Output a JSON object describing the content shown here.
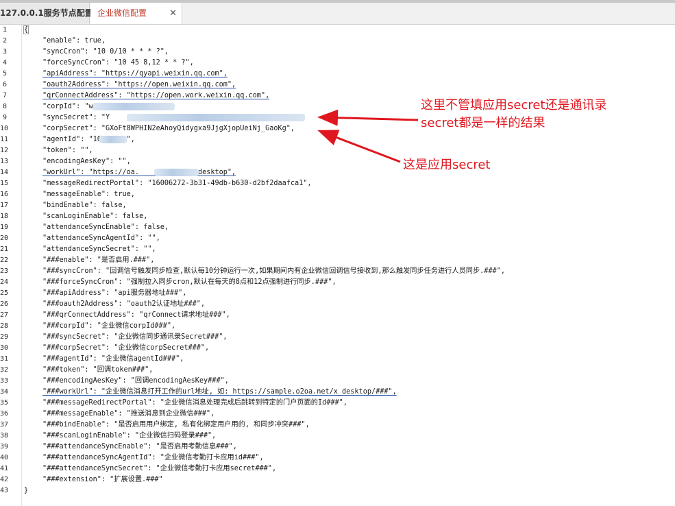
{
  "tabs": [
    {
      "label": "127.0.0.1服务节点配置"
    },
    {
      "label": "企业微信配置",
      "close": "✕"
    }
  ],
  "code_lines": [
    {
      "n": "1",
      "text": "{"
    },
    {
      "n": "2",
      "text": "\"enable\": true,"
    },
    {
      "n": "3",
      "text": "\"syncCron\": \"10 0/10 * * * ?\","
    },
    {
      "n": "4",
      "text": "\"forceSyncCron\": \"10 45 8,12 * * ?\","
    },
    {
      "n": "5",
      "text": "\"apiAddress\": \"https://qyapi.weixin.qq.com\","
    },
    {
      "n": "6",
      "text": "\"oauth2Address\": \"https://open.weixin.qq.com\","
    },
    {
      "n": "7",
      "text": "\"qrConnectAddress\": \"https://open.work.weixin.qq.com\","
    },
    {
      "n": "8",
      "text": "\"corpId\": \"w               d\","
    },
    {
      "n": "9",
      "text": "\"syncSecret\": \"Y                                M\","
    },
    {
      "n": "10",
      "text": "\"corpSecret\": \"GXoFt8WPHIN2eAhoyQidygxa9JjgXjopUeiNj_GaoKg\","
    },
    {
      "n": "11",
      "text": "\"agentId\": \"10    83\","
    },
    {
      "n": "12",
      "text": "\"token\": \"\","
    },
    {
      "n": "13",
      "text": "\"encodingAesKey\": \"\","
    },
    {
      "n": "14",
      "text": "\"workUrl\": \"https://oa.         om/x_desktop\","
    },
    {
      "n": "15",
      "text": "\"messageRedirectPortal\": \"16006272-3b31-49db-b630-d2bf2daafca1\","
    },
    {
      "n": "16",
      "text": "\"messageEnable\": true,"
    },
    {
      "n": "17",
      "text": "\"bindEnable\": false,"
    },
    {
      "n": "18",
      "text": "\"scanLoginEnable\": false,"
    },
    {
      "n": "19",
      "text": "\"attendanceSyncEnable\": false,"
    },
    {
      "n": "20",
      "text": "\"attendanceSyncAgentId\": \"\","
    },
    {
      "n": "21",
      "text": "\"attendanceSyncSecret\": \"\","
    },
    {
      "n": "22",
      "text": "\"###enable\": \"是否启用.###\","
    },
    {
      "n": "23",
      "text": "\"###syncCron\": \"回调信号触发同步检查,默认每10分钟运行一次,如果期间内有企业微信回调信号接收到,那么触发同步任务进行人员同步.###\","
    },
    {
      "n": "24",
      "text": "\"###forceSyncCron\": \"强制拉入同步cron,默认在每天的8点和12点强制进行同步.###\","
    },
    {
      "n": "25",
      "text": "\"###apiAddress\": \"api服务器地址###\","
    },
    {
      "n": "26",
      "text": "\"###oauth2Address\": \"oauth2认证地址###\","
    },
    {
      "n": "27",
      "text": "\"###qrConnectAddress\": \"qrConnect请求地址###\","
    },
    {
      "n": "28",
      "text": "\"###corpId\": \"企业微信corpId###\","
    },
    {
      "n": "29",
      "text": "\"###syncSecret\": \"企业微信同步通讯录Secret###\","
    },
    {
      "n": "30",
      "text": "\"###corpSecret\": \"企业微信corpSecret###\","
    },
    {
      "n": "31",
      "text": "\"###agentId\": \"企业微信agentId###\","
    },
    {
      "n": "32",
      "text": "\"###token\": \"回调token###\","
    },
    {
      "n": "33",
      "text": "\"###encodingAesKey\": \"回调encodingAesKey###\","
    },
    {
      "n": "34",
      "text": "\"###workUrl\": \"企业微信消息打开工作的url地址, 如: https://sample.o2oa.net/x_desktop/###\","
    },
    {
      "n": "35",
      "text": "\"###messageRedirectPortal\": \"企业微信消息处理完成后跳转到特定的门户页面的Id###\","
    },
    {
      "n": "36",
      "text": "\"###messageEnable\": \"推送消息到企业微信###\","
    },
    {
      "n": "37",
      "text": "\"###bindEnable\": \"是否启用用户绑定, 私有化绑定用户用的, 和同步冲突###\","
    },
    {
      "n": "38",
      "text": "\"###scanLoginEnable\": \"企业微信扫码登录###\","
    },
    {
      "n": "39",
      "text": "\"###attendanceSyncEnable\": \"是否启用考勤信息###\","
    },
    {
      "n": "40",
      "text": "\"###attendanceSyncAgentId\": \"企业微信考勤打卡应用id###\","
    },
    {
      "n": "41",
      "text": "\"###attendanceSyncSecret\": \"企业微信考勤打卡应用secret###\","
    },
    {
      "n": "42",
      "text": "\"###extension\": \"扩展设置.###\""
    },
    {
      "n": "43",
      "text": "}"
    }
  ],
  "annotations": {
    "note1_line1": "这里不管填应用secret还是通讯录",
    "note1_line2": "secret都是一样的结果",
    "note2": "这是应用secret"
  },
  "colors": {
    "annotation": "#e0171f",
    "active_tab_text": "#c0392b"
  }
}
